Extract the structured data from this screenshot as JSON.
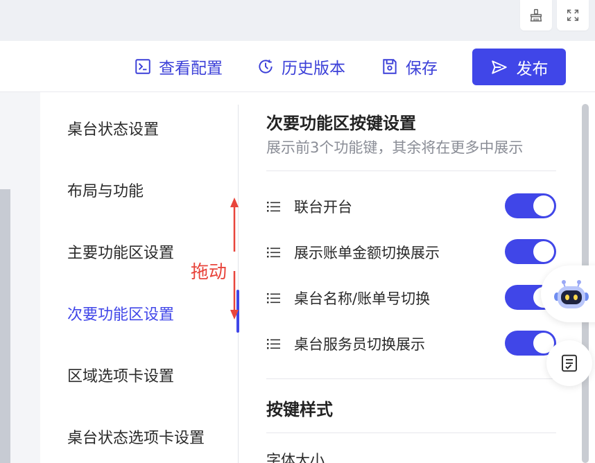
{
  "toolbar": {
    "view_config_label": "查看配置",
    "history_label": "历史版本",
    "save_label": "保存",
    "publish_label": "发布"
  },
  "nav": {
    "items": [
      {
        "label": "桌台状态设置"
      },
      {
        "label": "布局与功能"
      },
      {
        "label": "主要功能区设置"
      },
      {
        "label": "次要功能区设置",
        "active": true
      },
      {
        "label": "区域选项卡设置"
      },
      {
        "label": "桌台状态选项卡设置"
      }
    ]
  },
  "annotation": {
    "text": "拖动"
  },
  "secondary_section": {
    "title": "次要功能区按键设置",
    "subtitle": "展示前3个功能键，其余将在更多中展示",
    "items": [
      {
        "label": "联台开台",
        "enabled": true
      },
      {
        "label": "展示账单金额切换展示",
        "enabled": true
      },
      {
        "label": "桌台名称/账单号切换",
        "enabled": true
      },
      {
        "label": "桌台服务员切换展示",
        "enabled": true
      }
    ]
  },
  "button_style_section": {
    "title": "按键样式",
    "font_size_label": "字体大小"
  },
  "colors": {
    "accent": "#4046e8",
    "annotation": "#e8453c"
  }
}
